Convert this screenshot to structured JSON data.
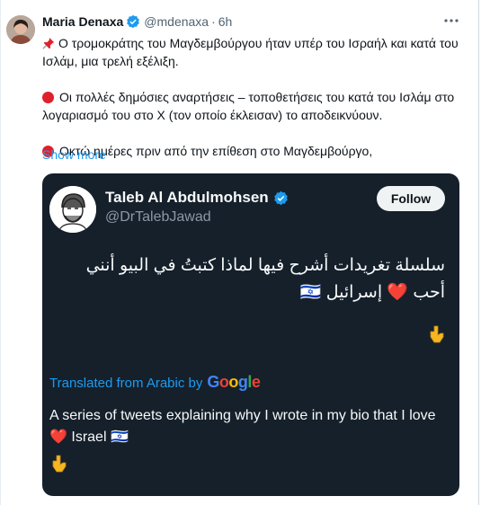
{
  "tweet": {
    "author_name": "Maria Denaxa",
    "author_handle": "@mdenaxa",
    "separator": "·",
    "time": "6h",
    "paragraphs": [
      "Ο τρομοκράτης του Μαγδεμβούργου ήταν υπέρ του Ισραήλ και κατά του Ισλάμ, μια τρελή εξέλιξη.",
      "Οι πολλές δημόσιες αναρτήσεις – τοποθετήσεις του κατά του Ισλάμ στο λογαριασμό του στο X (τον οποίο έκλεισαν) το αποδεικνύουν.",
      "Οκτώ ημέρες πριν από την επίθεση στο Μαγδεμβούργο,"
    ],
    "show_more": "Show more"
  },
  "quoted": {
    "name": "Taleb Al Abdulmohsen",
    "handle": "@DrTalebJawad",
    "follow_label": "Follow",
    "arabic_text": "سلسلة تغريدات أشرح فيها لماذا كتبتُ في البيو أنني أحب ❤️ إسرائيل 🇮🇱",
    "translated_prefix": "Translated from Arabic by",
    "translated_brand": "Google",
    "english_text": "A series of tweets explaining why I wrote in my bio that I love ❤️ Israel 🇮🇱"
  },
  "colors": {
    "link": "#1d9bf0",
    "card_bg": "#15202b",
    "verified": "#1d9bf0",
    "red_dot": "#e0202c"
  },
  "icons": [
    "verified-badge-icon",
    "more-icon",
    "pushpin-icon",
    "red-circle-icon",
    "heart-icon",
    "israel-flag-icon",
    "pointing-down-icon"
  ]
}
